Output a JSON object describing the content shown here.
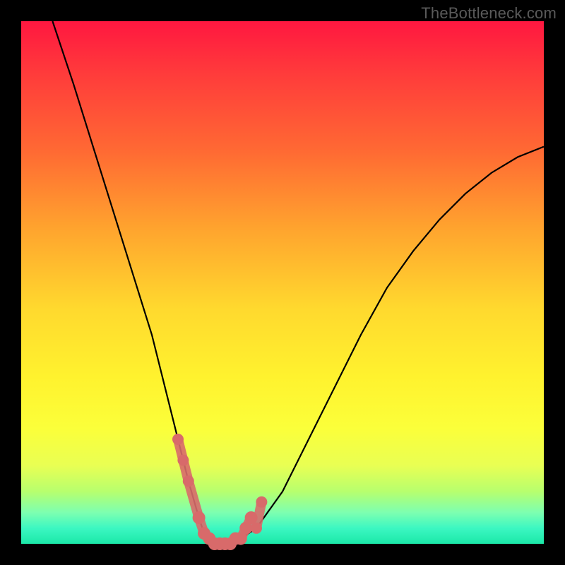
{
  "watermark": "TheBottleneck.com",
  "chart_data": {
    "type": "line",
    "title": "",
    "xlabel": "",
    "ylabel": "",
    "xlim": [
      0,
      100
    ],
    "ylim": [
      0,
      100
    ],
    "grid": false,
    "annotations": [
      "Rainbow gradient background (red top to green bottom) with black V-shaped curve and salmon dotted segment near valley"
    ],
    "series": [
      {
        "name": "main-curve",
        "color": "#000000",
        "x": [
          6,
          10,
          15,
          20,
          25,
          28,
          30,
          32,
          34,
          35,
          36,
          37,
          38,
          40,
          42,
          45,
          50,
          55,
          60,
          65,
          70,
          75,
          80,
          85,
          90,
          95,
          100
        ],
        "y": [
          100,
          88,
          72,
          56,
          40,
          28,
          20,
          12,
          5,
          2,
          1,
          0,
          0,
          0,
          1,
          3,
          10,
          20,
          30,
          40,
          49,
          56,
          62,
          67,
          71,
          74,
          76
        ]
      },
      {
        "name": "highlight-dots",
        "color": "#d86a6a",
        "x": [
          30,
          31,
          32,
          34,
          35,
          36,
          37,
          38,
          39,
          40,
          41,
          42,
          43,
          44,
          45,
          46
        ],
        "y": [
          20,
          16,
          12,
          5,
          2,
          1,
          0,
          0,
          0,
          0,
          1,
          1,
          3,
          5,
          3,
          8
        ]
      }
    ]
  }
}
